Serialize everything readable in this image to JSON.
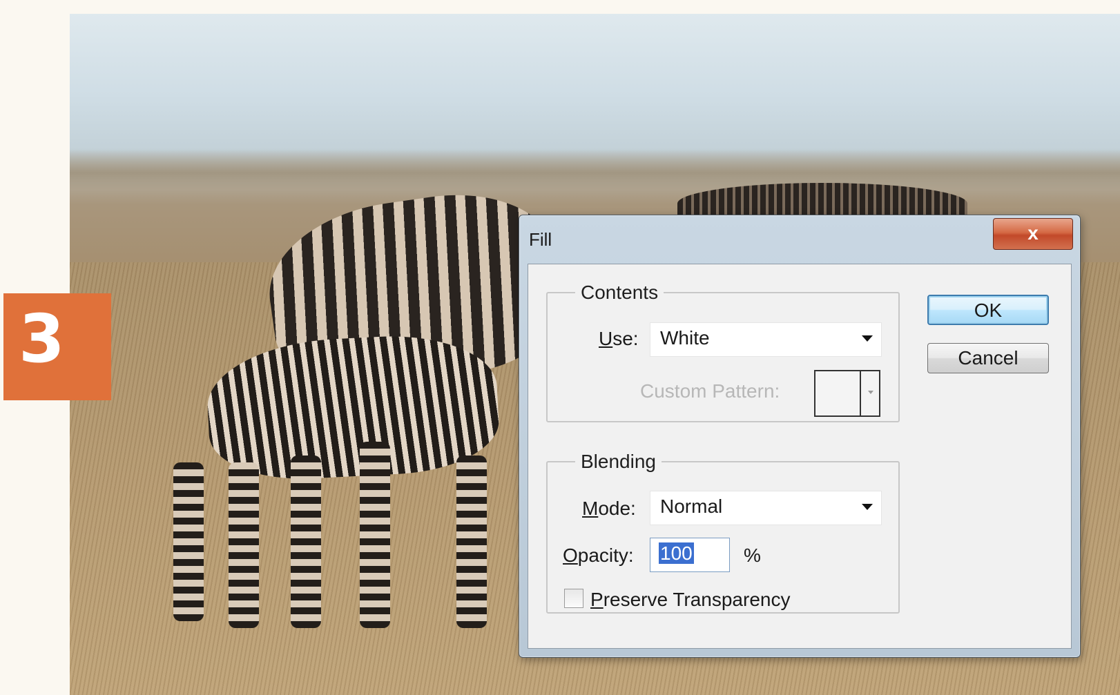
{
  "step": {
    "number": "3"
  },
  "dialog": {
    "title": "Fill",
    "close_label": "x",
    "contents": {
      "legend": "Contents",
      "use": {
        "label_accel": "U",
        "label_rest": "se:",
        "value": "White"
      },
      "custom_pattern_label": "Custom Pattern:"
    },
    "blending": {
      "legend": "Blending",
      "mode": {
        "label_accel": "M",
        "label_rest": "ode:",
        "value": "Normal"
      },
      "opacity": {
        "label_accel": "O",
        "label_rest": "pacity:",
        "value": "100",
        "unit": "%"
      },
      "preserve": {
        "label_accel": "P",
        "label_rest": "reserve Transparency",
        "checked": false
      }
    },
    "buttons": {
      "ok": "OK",
      "cancel": "Cancel"
    }
  }
}
